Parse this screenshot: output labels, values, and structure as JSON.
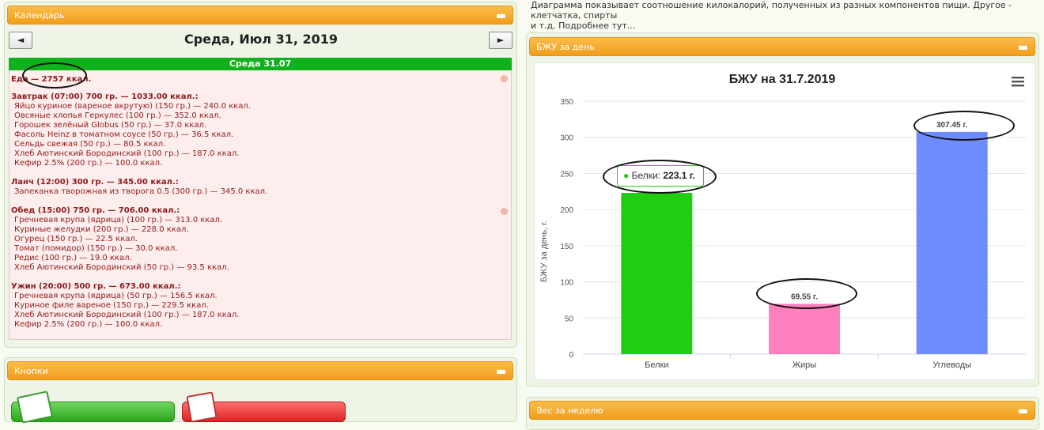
{
  "info_text": {
    "line1": "Диаграмма показывает соотношение килокалорий, полученных из разных компонентов пищи. Другое - клетчатка, спирты",
    "line2": "и т.д. Подробнее тут..."
  },
  "calendar_panel": {
    "title": "Календарь",
    "collapse": "▬",
    "prev": "◄",
    "next": "►",
    "date": "Среда, Июл 31, 2019",
    "day_label": "Среда 31.07",
    "total": "Еда — 2757 ккал.",
    "meals": [
      {
        "header": "Завтрак (07:00) 700 гр. — 1033.00 ккал.:",
        "items": [
          "Яйцо куриное (вареное вкрутую) (150 гр.) — 240.0 ккал.",
          "Овсяные хлопья Геркулес (100 гр.) — 352.0 ккал.",
          "Горошек зелёный Globus (50 гр.) — 37.0 ккал.",
          "Фасоль Heinz в томатном соусе (50 гр.) — 36.5 ккал.",
          "Сельдь свежая (50 гр.) — 80.5 ккал.",
          "Хлеб Аютинский Бородинский (100 гр.) — 187.0 ккал.",
          "Кефир 2.5% (200 гр.) — 100.0 ккал."
        ]
      },
      {
        "header": "Ланч (12:00) 300 гр. — 345.00 ккал.:",
        "items": [
          "Запеканка творожная из творога 0.5 (300 гр.) — 345.0 ккал."
        ]
      },
      {
        "header": "Обед (15:00) 750 гр. — 706.00 ккал.:",
        "items": [
          "Гречневая крупа (ядрица) (100 гр.) — 313.0 ккал.",
          "Куриные желудки (200 гр.) — 228.0 ккал.",
          "Огурец (150 гр.) — 22.5 ккал.",
          "Томат (помидор) (150 гр.) — 30.0 ккал.",
          "Редис (100 гр.) — 19.0 ккал.",
          "Хлеб Аютинский Бородинский (50 гр.) — 93.5 ккал."
        ]
      },
      {
        "header": "Ужин (20:00) 500 гр. — 673.00 ккал.:",
        "items": [
          "Гречневая крупа (ядрица) (50 гр.) — 156.5 ккал.",
          "Куриное филе вареное (150 гр.) — 229.5 ккал.",
          "Хлеб Аютинский Бородинский (100 гр.) — 187.0 ккал.",
          "Кефир 2.5% (200 гр.) — 100.0 ккал."
        ]
      }
    ]
  },
  "buttons_panel": {
    "title": "Кнопки",
    "collapse": "▬"
  },
  "bju_panel": {
    "title": "БЖУ за день",
    "collapse": "▬",
    "menu_icon": "menu-icon"
  },
  "weight_panel": {
    "title": "Вес за неделю",
    "collapse": "▬"
  },
  "tooltip": {
    "label": "Белки:",
    "value": "223.1 г."
  },
  "chart_data": {
    "type": "bar",
    "title": "БЖУ на 31.7.2019",
    "ylabel": "БЖУ за день, г.",
    "xlabel": "",
    "ylim": [
      0,
      350
    ],
    "yticks": [
      0,
      50,
      100,
      150,
      200,
      250,
      300,
      350
    ],
    "categories": [
      "Белки",
      "Жиры",
      "Углеводы"
    ],
    "values": [
      223.1,
      69.55,
      307.45
    ],
    "data_labels": [
      "",
      "69.55 г.",
      "307.45 г."
    ],
    "colors": [
      "#22cc11",
      "#ff7fbf",
      "#6f8cff"
    ],
    "grid": true
  }
}
